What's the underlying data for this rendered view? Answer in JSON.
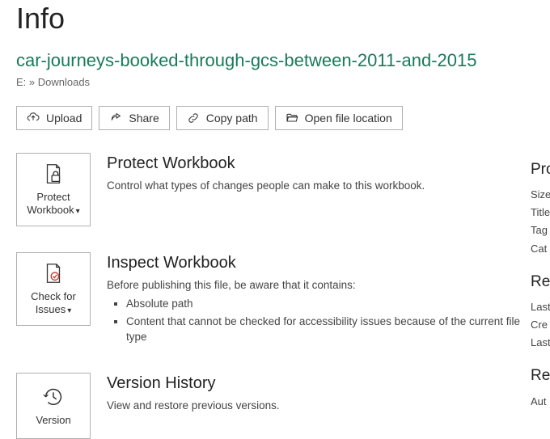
{
  "page": {
    "title": "Info",
    "filename": "car-journeys-booked-through-gcs-between-2011-and-2015",
    "breadcrumb": "E: » Downloads"
  },
  "actions": {
    "upload": "Upload",
    "share": "Share",
    "copypath": "Copy path",
    "openloc": "Open file location"
  },
  "sections": {
    "protect": {
      "button": "Protect Workbook",
      "title": "Protect Workbook",
      "desc": "Control what types of changes people can make to this workbook."
    },
    "inspect": {
      "button": "Check for Issues",
      "title": "Inspect Workbook",
      "intro": "Before publishing this file, be aware that it contains:",
      "item1": "Absolute path",
      "item2": "Content that cannot be checked for accessibility issues because of the current file type"
    },
    "version": {
      "button": "Version",
      "title": "Version History",
      "desc": "View and restore previous versions."
    }
  },
  "sidebar": {
    "h1": "Pro",
    "size": "Size",
    "title": "Title",
    "tags": "Tag",
    "categories": "Cat",
    "h2": "Rel",
    "lastmod": "Last",
    "created": "Cre",
    "lastprint": "Last",
    "h3": "Rel",
    "author": "Aut"
  }
}
